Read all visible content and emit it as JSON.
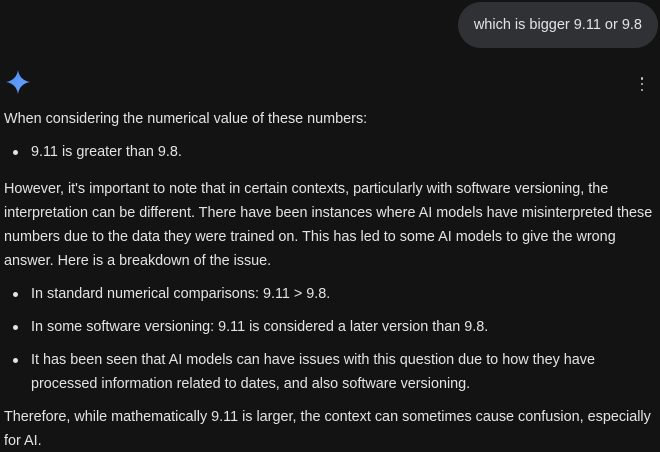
{
  "user_message": {
    "text": "which is bigger 9.11 or 9.8"
  },
  "assistant_icon": "gemini-sparkle-icon",
  "menu_icon": "more-vert-icon",
  "response": {
    "intro": "When considering the numerical value of these numbers:",
    "list_1": [
      "9.11 is greater than 9.8."
    ],
    "however": "However, it's important to note that in certain contexts, particularly with software versioning, the interpretation can be different. There have been instances where AI models have misinterpreted these numbers due to the data they were trained on. This has led to some AI models to give the wrong answer. Here is a breakdown of the issue.",
    "list_2": [
      "In standard numerical comparisons: 9.11 > 9.8.",
      "In some software versioning: 9.11 is considered a later version than 9.8.",
      "It has been seen that AI models can have issues with this question due to how they have processed information related to dates, and also software versioning."
    ],
    "therefore": "Therefore, while mathematically 9.11 is larger, the context can sometimes cause confusion, especially for AI."
  },
  "colors": {
    "background": "#131314",
    "bubble": "#303134",
    "text": "#e3e3e3",
    "sparkle": "#4f8df5"
  }
}
